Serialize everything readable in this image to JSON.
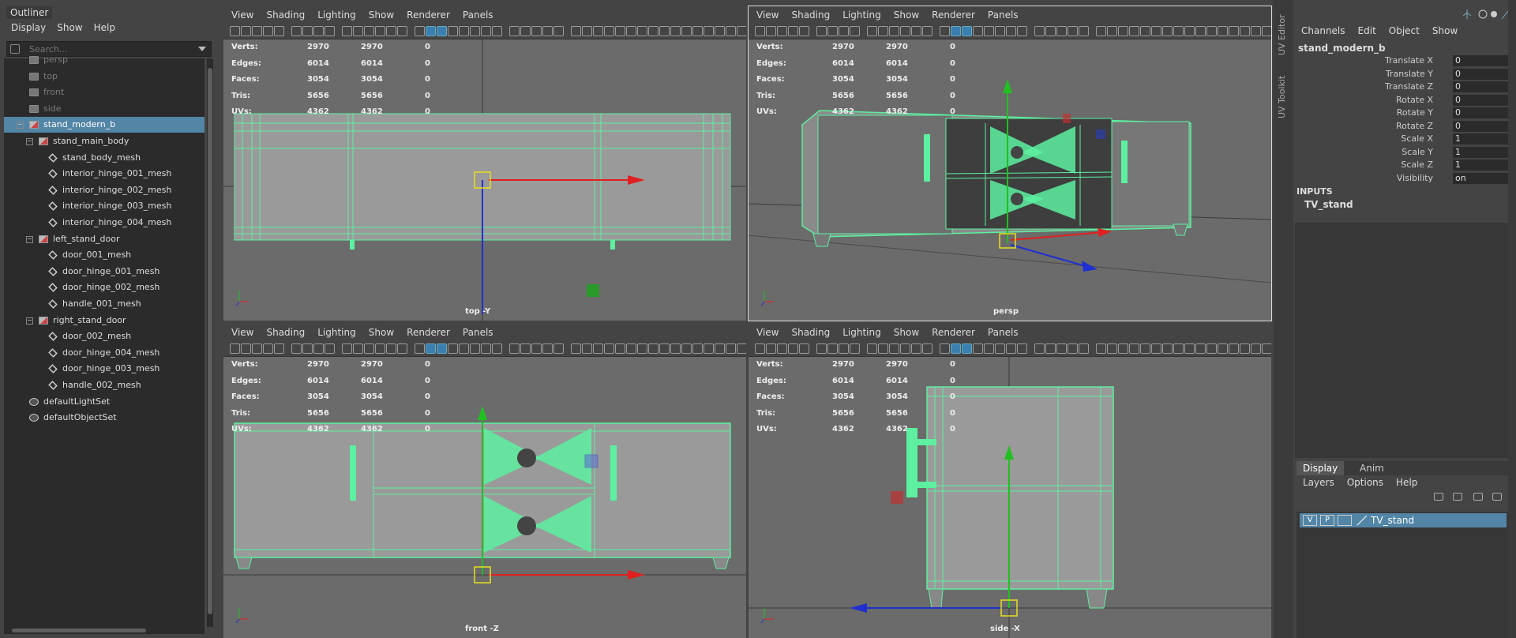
{
  "outliner": {
    "title": "Outliner",
    "menu": [
      "Display",
      "Show",
      "Help"
    ],
    "search_placeholder": "Search...",
    "items": [
      {
        "label": "persp",
        "type": "camera",
        "depth": 0
      },
      {
        "label": "top",
        "type": "camera",
        "depth": 0
      },
      {
        "label": "front",
        "type": "camera",
        "depth": 0
      },
      {
        "label": "side",
        "type": "camera",
        "depth": 0
      },
      {
        "label": "stand_modern_b",
        "type": "group",
        "depth": 0,
        "selected": true
      },
      {
        "label": "stand_main_body",
        "type": "group",
        "depth": 1
      },
      {
        "label": "stand_body_mesh",
        "type": "mesh",
        "depth": 2
      },
      {
        "label": "interior_hinge_001_mesh",
        "type": "mesh",
        "depth": 2
      },
      {
        "label": "interior_hinge_002_mesh",
        "type": "mesh",
        "depth": 2
      },
      {
        "label": "interior_hinge_003_mesh",
        "type": "mesh",
        "depth": 2
      },
      {
        "label": "interior_hinge_004_mesh",
        "type": "mesh",
        "depth": 2
      },
      {
        "label": "left_stand_door",
        "type": "group",
        "depth": 1
      },
      {
        "label": "door_001_mesh",
        "type": "mesh",
        "depth": 2
      },
      {
        "label": "door_hinge_001_mesh",
        "type": "mesh",
        "depth": 2
      },
      {
        "label": "door_hinge_002_mesh",
        "type": "mesh",
        "depth": 2
      },
      {
        "label": "handle_001_mesh",
        "type": "mesh",
        "depth": 2
      },
      {
        "label": "right_stand_door",
        "type": "group",
        "depth": 1
      },
      {
        "label": "door_002_mesh",
        "type": "mesh",
        "depth": 2
      },
      {
        "label": "door_hinge_004_mesh",
        "type": "mesh",
        "depth": 2
      },
      {
        "label": "door_hinge_003_mesh",
        "type": "mesh",
        "depth": 2
      },
      {
        "label": "handle_002_mesh",
        "type": "mesh",
        "depth": 2
      },
      {
        "label": "defaultLightSet",
        "type": "set",
        "depth": 0
      },
      {
        "label": "defaultObjectSet",
        "type": "set",
        "depth": 0
      }
    ]
  },
  "viewport_menu": [
    "View",
    "Shading",
    "Lighting",
    "Show",
    "Renderer",
    "Panels"
  ],
  "stats": {
    "labels": [
      "Verts:",
      "Edges:",
      "Faces:",
      "Tris:",
      "UVs:"
    ],
    "col1": [
      "2970",
      "6014",
      "3054",
      "5656",
      "4362"
    ],
    "col2": [
      "2970",
      "6014",
      "3054",
      "5656",
      "4362"
    ],
    "col3": [
      "0",
      "0",
      "0",
      "0",
      "0"
    ]
  },
  "viewports": {
    "top": {
      "label": "top -Y"
    },
    "persp": {
      "label": "persp"
    },
    "front": {
      "label": "front -Z"
    },
    "side": {
      "label": "side -X"
    }
  },
  "side_tabs": [
    "UV Editor",
    "UV Toolkit"
  ],
  "channels": {
    "menu": [
      "Channels",
      "Edit",
      "Object",
      "Show"
    ],
    "object_name": "stand_modern_b",
    "attributes": [
      {
        "name": "Translate X",
        "value": "0"
      },
      {
        "name": "Translate Y",
        "value": "0"
      },
      {
        "name": "Translate Z",
        "value": "0"
      },
      {
        "name": "Rotate X",
        "value": "0"
      },
      {
        "name": "Rotate Y",
        "value": "0"
      },
      {
        "name": "Rotate Z",
        "value": "0"
      },
      {
        "name": "Scale X",
        "value": "1"
      },
      {
        "name": "Scale Y",
        "value": "1"
      },
      {
        "name": "Scale Z",
        "value": "1"
      },
      {
        "name": "Visibility",
        "value": "on"
      }
    ],
    "inputs_label": "INPUTS",
    "inputs_node": "TV_stand"
  },
  "layers": {
    "tabs": [
      "Display",
      "Anim"
    ],
    "menu": [
      "Layers",
      "Options",
      "Help"
    ],
    "rows": [
      {
        "v": "V",
        "p": "P",
        "name": "TV_stand"
      }
    ]
  },
  "colors": {
    "wire": "#5cf0a0",
    "selected": "#5285a6",
    "viewport_bg": "#6b6b6b",
    "panel_bg": "#444444"
  }
}
